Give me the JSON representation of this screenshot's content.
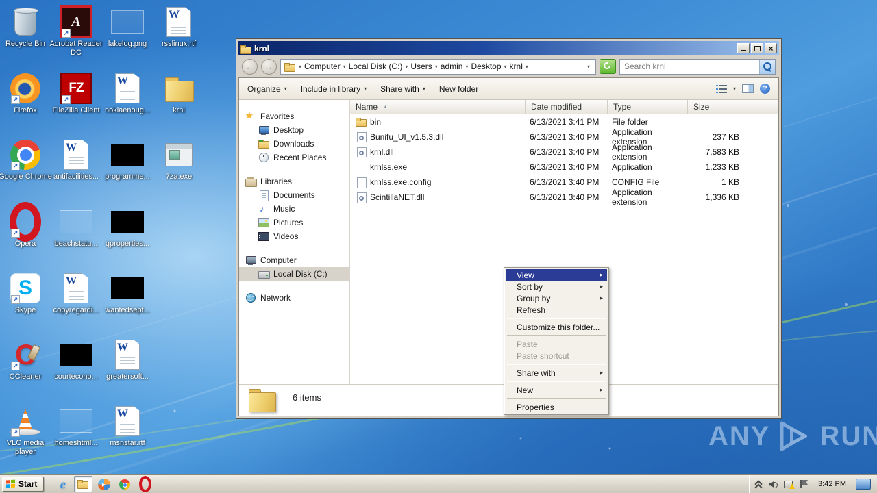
{
  "colors": {
    "titlebar_gradient_start": "#0b2569",
    "titlebar_gradient_end": "#9ec2ee",
    "menu_highlight": "#2b3c97",
    "desktop_blue": "#3c8ad4",
    "sidebar_selection": "#d7d3ca"
  },
  "desktop": {
    "icons": [
      {
        "label": "Recycle Bin",
        "type": "trash",
        "col": 0,
        "row": 0,
        "shortcut": false
      },
      {
        "label": "Acrobat Reader DC",
        "type": "acrobat",
        "col": 1,
        "row": 0,
        "shortcut": true
      },
      {
        "label": "lakelog.png",
        "type": "ghost",
        "col": 2,
        "row": 0,
        "shortcut": false
      },
      {
        "label": "rsslinux.rtf",
        "type": "word",
        "col": 3,
        "row": 0,
        "shortcut": false
      },
      {
        "label": "Firefox",
        "type": "firefox",
        "col": 0,
        "row": 1,
        "shortcut": true
      },
      {
        "label": "FileZilla Client",
        "type": "filezilla",
        "col": 1,
        "row": 1,
        "shortcut": true
      },
      {
        "label": "nokiaenoug...",
        "type": "word",
        "col": 2,
        "row": 1,
        "shortcut": false
      },
      {
        "label": "krnl",
        "type": "folder",
        "col": 3,
        "row": 1,
        "shortcut": false
      },
      {
        "label": "Google Chrome",
        "type": "chrome",
        "col": 0,
        "row": 2,
        "shortcut": true
      },
      {
        "label": "antifacilities...",
        "type": "word",
        "col": 1,
        "row": 2,
        "shortcut": false
      },
      {
        "label": "programme...",
        "type": "black",
        "col": 2,
        "row": 2,
        "shortcut": false
      },
      {
        "label": "7za.exe",
        "type": "app",
        "col": 3,
        "row": 2,
        "shortcut": false
      },
      {
        "label": "Opera",
        "type": "opera",
        "col": 0,
        "row": 3,
        "shortcut": true
      },
      {
        "label": "beachstatu...",
        "type": "ghost",
        "col": 1,
        "row": 3,
        "shortcut": false
      },
      {
        "label": "qproperties...",
        "type": "black",
        "col": 2,
        "row": 3,
        "shortcut": false
      },
      {
        "label": "Skype",
        "type": "skype",
        "col": 0,
        "row": 4,
        "shortcut": true
      },
      {
        "label": "copyregardi...",
        "type": "word",
        "col": 1,
        "row": 4,
        "shortcut": false
      },
      {
        "label": "wantedsept...",
        "type": "black",
        "col": 2,
        "row": 4,
        "shortcut": false
      },
      {
        "label": "CCleaner",
        "type": "ccleaner",
        "col": 0,
        "row": 5,
        "shortcut": true
      },
      {
        "label": "courtecono...",
        "type": "black",
        "col": 1,
        "row": 5,
        "shortcut": false
      },
      {
        "label": "greatersoft...",
        "type": "word",
        "col": 2,
        "row": 5,
        "shortcut": false
      },
      {
        "label": "VLC media player",
        "type": "vlc",
        "col": 0,
        "row": 6,
        "shortcut": true
      },
      {
        "label": "homeshtml...",
        "type": "ghost",
        "col": 1,
        "row": 6,
        "shortcut": false
      },
      {
        "label": "msnstar.rtf",
        "type": "word",
        "col": 2,
        "row": 6,
        "shortcut": false
      }
    ]
  },
  "window": {
    "title": "krnl",
    "crumbs": [
      {
        "label": "Computer"
      },
      {
        "label": "Local Disk (C:)"
      },
      {
        "label": "Users"
      },
      {
        "label": "admin"
      },
      {
        "label": "Desktop"
      },
      {
        "label": "krnl"
      }
    ],
    "search_placeholder": "Search krnl",
    "toolbar": {
      "organize": "Organize",
      "include_in_library": "Include in library",
      "share_with": "Share with",
      "new_folder": "New folder"
    },
    "columns": [
      {
        "label": "Name",
        "sorted": true
      },
      {
        "label": "Date modified",
        "sorted": false
      },
      {
        "label": "Type",
        "sorted": false
      },
      {
        "label": "Size",
        "sorted": false
      },
      {
        "label": "",
        "sorted": false
      }
    ],
    "files": [
      {
        "icon": "folder",
        "name": "bin",
        "date": "6/13/2021 3:41 PM",
        "type": "File folder",
        "size": ""
      },
      {
        "icon": "dll",
        "name": "Bunifu_UI_v1.5.3.dll",
        "date": "6/13/2021 3:40 PM",
        "type": "Application extension",
        "size": "237 KB"
      },
      {
        "icon": "dll",
        "name": "krnl.dll",
        "date": "6/13/2021 3:40 PM",
        "type": "Application extension",
        "size": "7,583 KB"
      },
      {
        "icon": "none",
        "name": "krnlss.exe",
        "date": "6/13/2021 3:40 PM",
        "type": "Application",
        "size": "1,233 KB"
      },
      {
        "icon": "config",
        "name": "krnlss.exe.config",
        "date": "6/13/2021 3:40 PM",
        "type": "CONFIG File",
        "size": "1 KB"
      },
      {
        "icon": "dll",
        "name": "ScintillaNET.dll",
        "date": "6/13/2021 3:40 PM",
        "type": "Application extension",
        "size": "1,336 KB"
      }
    ],
    "sidebar": [
      {
        "label": "Favorites",
        "icon": "star",
        "root": true
      },
      {
        "label": "Desktop",
        "icon": "desktop"
      },
      {
        "label": "Downloads",
        "icon": "downloads"
      },
      {
        "label": "Recent Places",
        "icon": "recent"
      },
      {
        "gap": true
      },
      {
        "label": "Libraries",
        "icon": "libraries",
        "root": true
      },
      {
        "label": "Documents",
        "icon": "document"
      },
      {
        "label": "Music",
        "icon": "music"
      },
      {
        "label": "Pictures",
        "icon": "pictures"
      },
      {
        "label": "Videos",
        "icon": "videos"
      },
      {
        "gap": true
      },
      {
        "label": "Computer",
        "icon": "computer",
        "root": true
      },
      {
        "label": "Local Disk (C:)",
        "icon": "disk",
        "selected": true
      },
      {
        "gap": true
      },
      {
        "label": "Network",
        "icon": "network",
        "root": true
      }
    ],
    "status": "6 items"
  },
  "context_menu": {
    "items": [
      {
        "label": "View",
        "arrow": true,
        "highlight": true
      },
      {
        "label": "Sort by",
        "arrow": true
      },
      {
        "label": "Group by",
        "arrow": true
      },
      {
        "label": "Refresh"
      },
      {
        "sep": true
      },
      {
        "label": "Customize this folder..."
      },
      {
        "sep": true
      },
      {
        "label": "Paste",
        "disabled": true
      },
      {
        "label": "Paste shortcut",
        "disabled": true
      },
      {
        "sep": true
      },
      {
        "label": "Share with",
        "arrow": true
      },
      {
        "sep": true
      },
      {
        "label": "New",
        "arrow": true
      },
      {
        "sep": true
      },
      {
        "label": "Properties"
      }
    ]
  },
  "taskbar": {
    "start_label": "Start",
    "quick_launch": [
      {
        "name": "internet-explorer",
        "active": false
      },
      {
        "name": "windows-explorer",
        "active": true
      },
      {
        "name": "media-player",
        "active": false
      },
      {
        "name": "chrome",
        "active": false
      },
      {
        "name": "opera",
        "active": false
      }
    ],
    "tray": [
      {
        "name": "hidden-icons-chevron"
      },
      {
        "name": "volume"
      },
      {
        "name": "network-warning"
      },
      {
        "name": "action-center-flag"
      }
    ],
    "time": "3:42 PM"
  },
  "watermark": {
    "left": "ANY",
    "right": "RUN"
  }
}
